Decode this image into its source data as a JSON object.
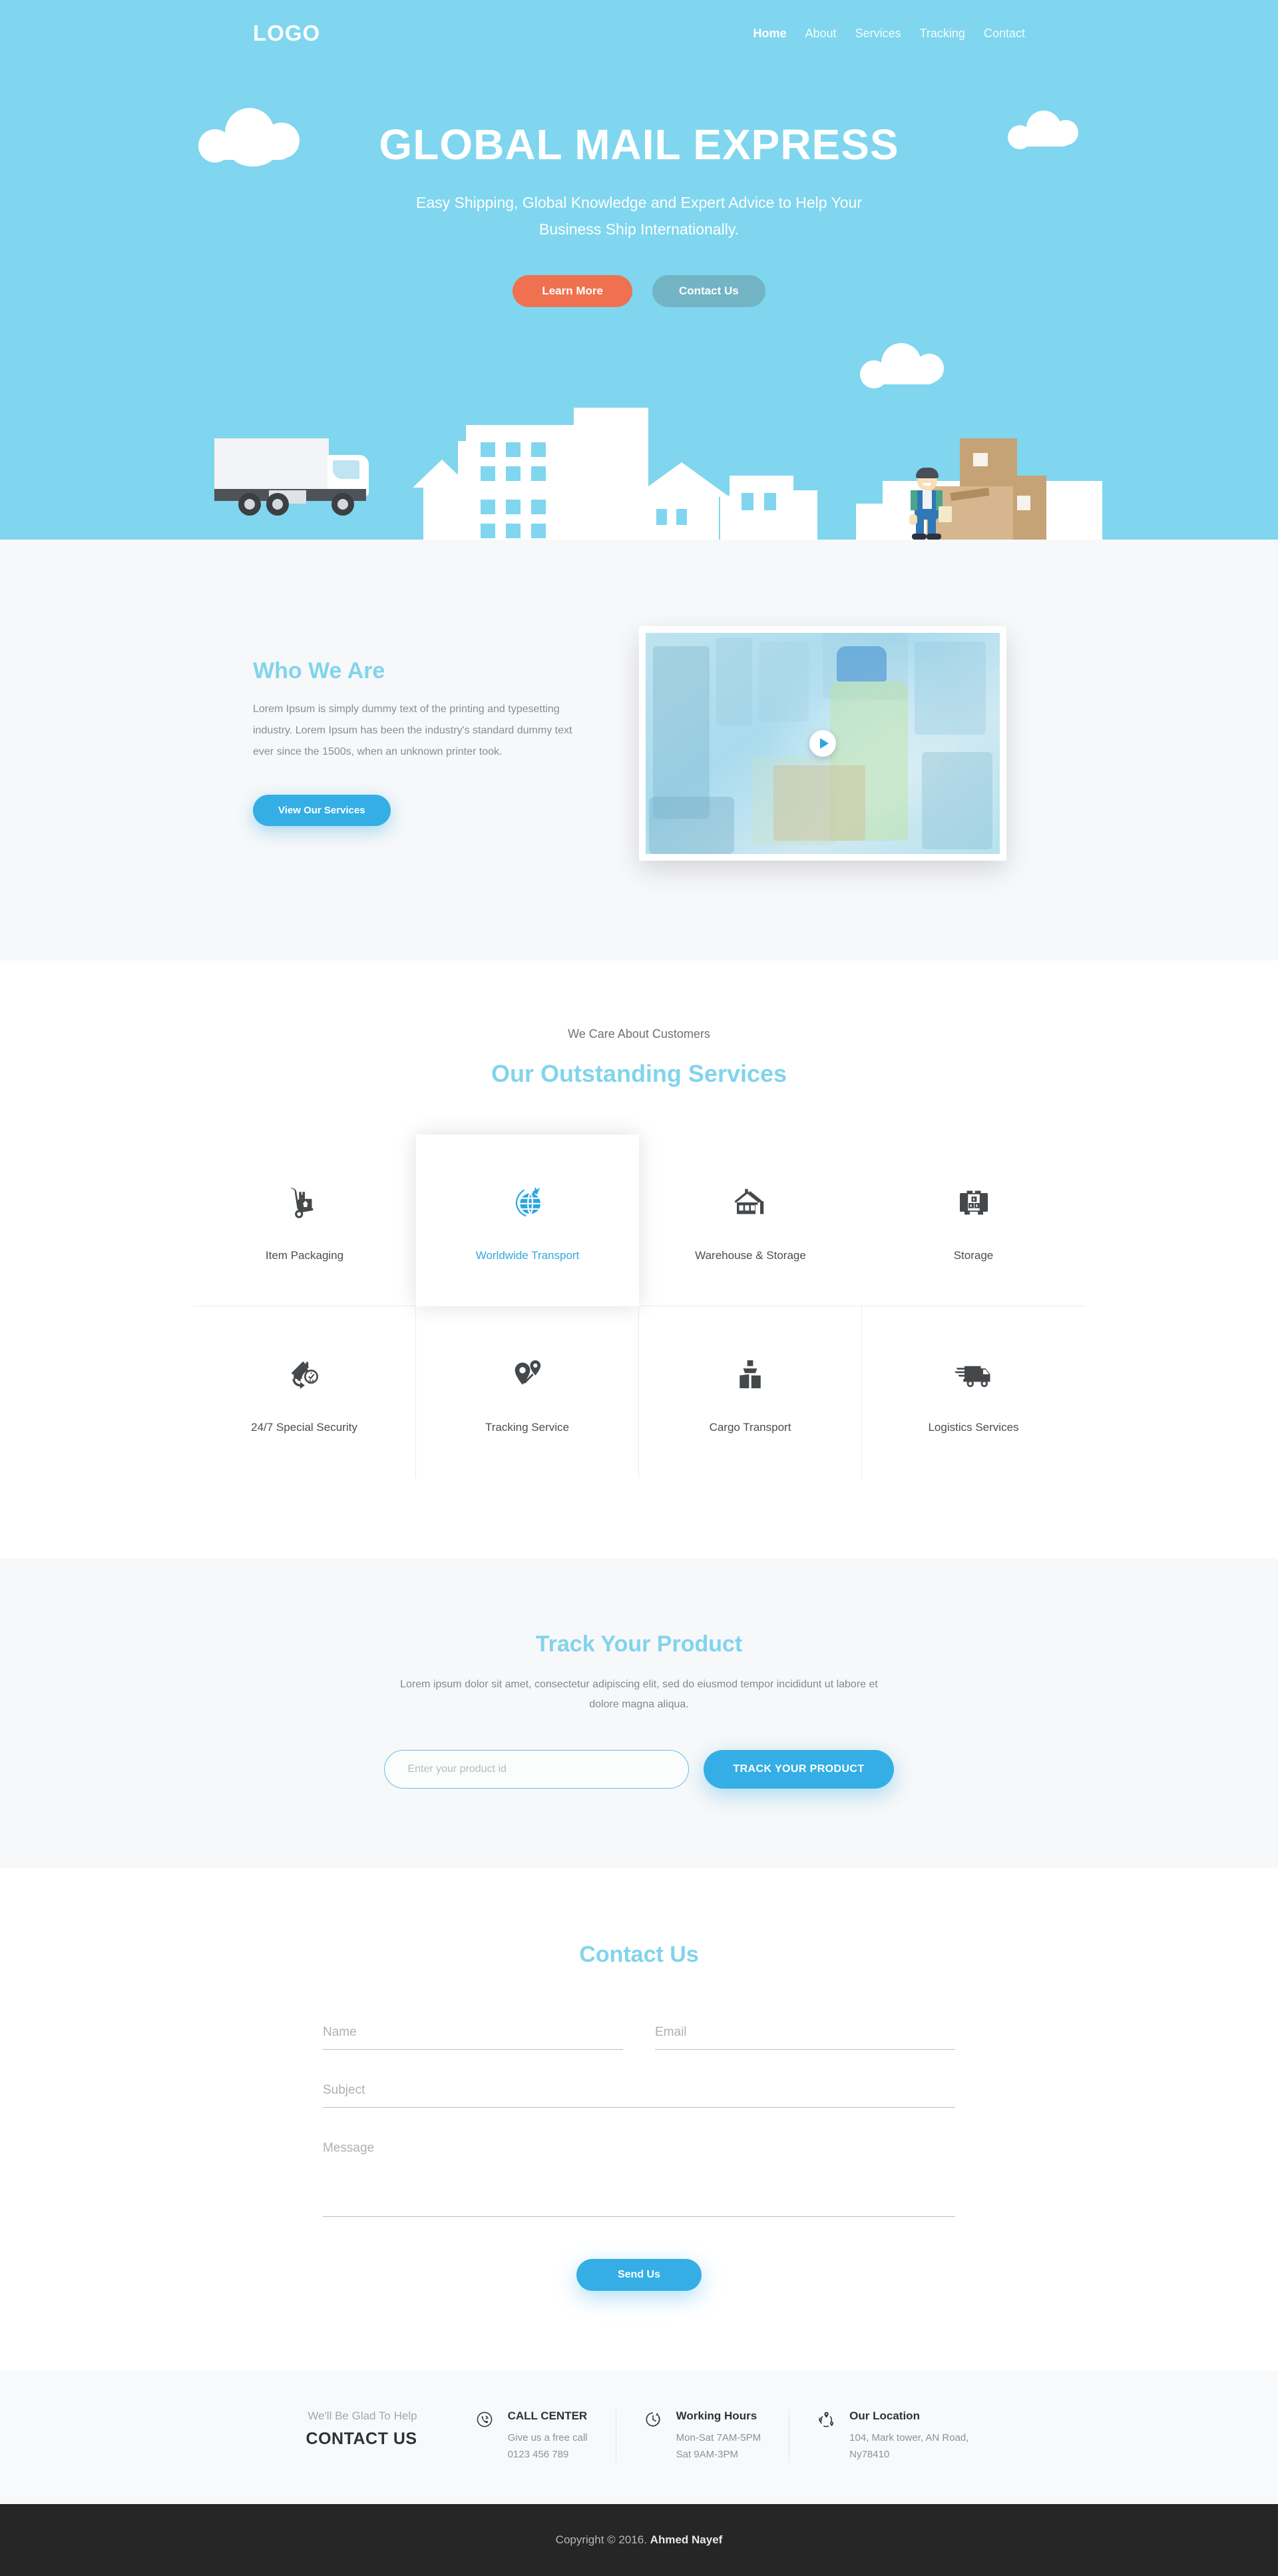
{
  "nav": {
    "logo": "LOGO",
    "links": [
      {
        "label": "Home",
        "active": true
      },
      {
        "label": "About",
        "active": false
      },
      {
        "label": "Services",
        "active": false
      },
      {
        "label": "Tracking",
        "active": false
      },
      {
        "label": "Contact",
        "active": false
      }
    ]
  },
  "hero": {
    "title": "GLOBAL MAIL EXPRESS",
    "subtitle": "Easy Shipping, Global Knowledge and Expert Advice to Help Your Business Ship Internationally.",
    "primary_button": "Learn More",
    "secondary_button": "Contact Us",
    "background_color": "#7fd6ee",
    "primary_color": "#f0714f",
    "secondary_color": "#72b4c4"
  },
  "who": {
    "title": "Who We Are",
    "body": "Lorem Ipsum is simply dummy text of the printing and typesetting industry. Lorem Ipsum has been the industry's standard dummy text ever since the 1500s, when an unknown printer took.",
    "button": "View Our Services",
    "video_play_icon": "play-icon",
    "accent_color": "#81d4ec"
  },
  "services": {
    "kicker": "We Care About Customers",
    "title": "Our Outstanding Services",
    "active_color": "#33a7e0",
    "items": [
      {
        "label": "Item Packaging",
        "icon": "hand-truck-icon",
        "active": false
      },
      {
        "label": "Worldwide Transport",
        "icon": "globe-plane-icon",
        "active": true
      },
      {
        "label": "Warehouse & Storage",
        "icon": "warehouse-house-icon",
        "active": false
      },
      {
        "label": "Storage",
        "icon": "storage-box-icon",
        "active": false
      },
      {
        "label": "24/7 Special Security",
        "icon": "house-clock-24-icon",
        "active": false
      },
      {
        "label": "Tracking Service",
        "icon": "map-pins-icon",
        "active": false
      },
      {
        "label": "Cargo Transport",
        "icon": "cargo-ship-icon",
        "active": false
      },
      {
        "label": "Logistics Services",
        "icon": "delivery-truck-icon",
        "active": false
      }
    ]
  },
  "track": {
    "title": "Track Your Product",
    "subtitle": "Lorem ipsum dolor sit amet, consectetur adipiscing elit, sed do eiusmod tempor incididunt ut labore et dolore magna aliqua.",
    "input_placeholder": "Enter your product id",
    "input_value": "",
    "button": "TRACK YOUR PRODUCT"
  },
  "contact": {
    "title": "Contact Us",
    "fields": {
      "name_placeholder": "Name",
      "email_placeholder": "Email",
      "subject_placeholder": "Subject",
      "message_placeholder": "Message"
    },
    "button": "Send Us"
  },
  "footer_info": {
    "kicker": "We'll Be Glad To Help",
    "title": "CONTACT US",
    "columns": [
      {
        "icon": "phone-ring-icon",
        "heading": "CALL CENTER",
        "line1": "Give us a free call",
        "line2": "0123 456 789"
      },
      {
        "icon": "clock-icon",
        "heading": "Working Hours",
        "line1": "Mon-Sat 7AM-5PM",
        "line2": "Sat 9AM-3PM"
      },
      {
        "icon": "location-pins-icon",
        "heading": "Our Location",
        "line1": "104, Mark tower, AN Road,",
        "line2": "Ny78410"
      }
    ]
  },
  "copyright": {
    "prefix": "Copyright © 2016. ",
    "name": "Ahmed Nayef",
    "background_color": "#262626"
  }
}
